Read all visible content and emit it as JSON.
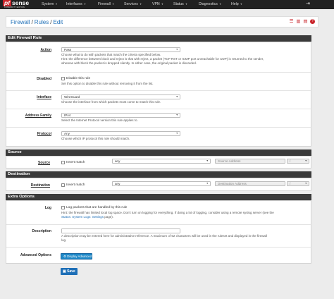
{
  "brand": {
    "logo_prefix": "pf",
    "logo_main": "sense",
    "edition": "COMMUNITY EDITION"
  },
  "nav": {
    "items": [
      "System",
      "Interfaces",
      "Firewall",
      "Services",
      "VPN",
      "Status",
      "Diagnostics",
      "Help"
    ],
    "exit_icon": "sign-out-icon"
  },
  "breadcrumb": {
    "firewall": "Firewall",
    "rules": "Rules",
    "edit": "Edit",
    "icons": [
      "sliders-icon",
      "bar-chart-icon",
      "list-icon",
      "help-icon"
    ]
  },
  "edit_rule": {
    "title": "Edit Firewall Rule",
    "action": {
      "label": "Action",
      "value": "Pass",
      "help1": "Choose what to do with packets that match the criteria specified below.",
      "help2": "Hint: the difference between block and reject is that with reject, a packet (TCP RST or ICMP port unreachable for UDP) is returned to the sender,",
      "help3": "whereas with block the packet is dropped silently. In either case, the original packet is discarded."
    },
    "disabled": {
      "label": "Disabled",
      "checkbox": "Disable this rule",
      "help": "Set this option to disable this rule without removing it from the list."
    },
    "interface": {
      "label": "Interface",
      "value": "WireGuard",
      "help": "Choose the interface from which packets must come to match this rule."
    },
    "address_family": {
      "label": "Address Family",
      "value": "IPv4",
      "help": "Select the Internet Protocol version this rule applies to."
    },
    "protocol": {
      "label": "Protocol",
      "value": "Any",
      "help": "Choose which IP protocol this rule should match."
    }
  },
  "source": {
    "title": "Source",
    "label": "Source",
    "invert": "Invert match",
    "type": "any",
    "address_placeholder": "Source Address",
    "slash": "/"
  },
  "destination": {
    "title": "Destination",
    "label": "Destination",
    "invert": "Invert match",
    "type": "any",
    "address_placeholder": "Destination Address",
    "slash": "/"
  },
  "extra": {
    "title": "Extra Options",
    "log": {
      "label": "Log",
      "checkbox": "Log packets that are handled by this rule",
      "help1": "Hint: the firewall has limited local log space. Don't turn on logging for everything. If doing a lot of logging, consider using a remote syslog server (see the",
      "help2_link": "Status: System Logs: Settings",
      "help2_rest": " page)."
    },
    "description": {
      "label": "Description",
      "help1": "A description may be entered here for administrative reference. A maximum of 52 characters will be used in the ruleset and displayed in the firewall",
      "help2": "log."
    },
    "advanced": {
      "label": "Advanced Options",
      "button": "Display Advanced"
    }
  },
  "save": "Save"
}
